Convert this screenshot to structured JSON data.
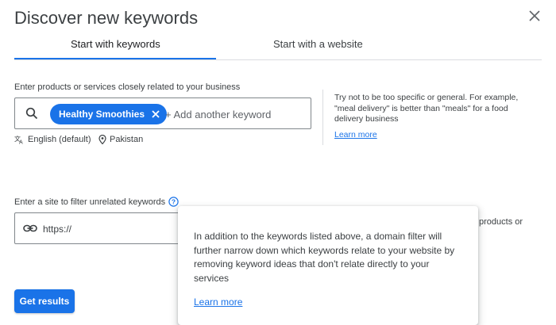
{
  "dialog": {
    "title": "Discover new keywords",
    "close_icon": "close-icon"
  },
  "tabs": [
    {
      "label": "Start with keywords",
      "active": true
    },
    {
      "label": "Start with a website",
      "active": false
    }
  ],
  "keywords_section": {
    "label": "Enter products or services closely related to your business",
    "chip_label": "Healthy Smoothies",
    "add_placeholder": "+ Add another keyword",
    "language": "English (default)",
    "location": "Pakistan"
  },
  "hint": {
    "text": "Try not to be too specific or general. For example, \"meal delivery\" is better than \"meals\" for a food delivery business",
    "learn_more": "Learn more"
  },
  "site_section": {
    "label": "Enter a site to filter unrelated keywords",
    "placeholder": "https://",
    "clipped_hint": "products or"
  },
  "tooltip": {
    "text": "In addition to the keywords listed above, a domain filter will further narrow down which keywords relate to your website by removing keyword ideas that don't relate directly to your services",
    "learn_more": "Learn more"
  },
  "actions": {
    "get_results": "Get results"
  },
  "colors": {
    "accent": "#1a73e8",
    "text": "#3c4043",
    "border": "#80868b"
  }
}
